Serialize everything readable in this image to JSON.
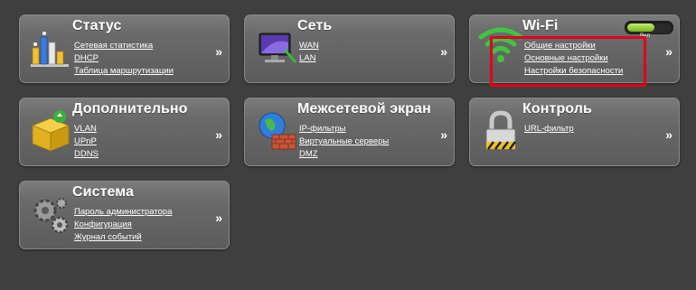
{
  "cards": {
    "status": {
      "title": "Статус",
      "links": [
        "Сетевая статистика",
        "DHCP",
        "Таблица маршрутизации"
      ],
      "arrow": "»"
    },
    "network": {
      "title": "Сеть",
      "links": [
        "WAN",
        "LAN"
      ],
      "arrow": "»"
    },
    "wifi": {
      "title": "Wi-Fi",
      "links": [
        "Общие настройки",
        "Основные настройки",
        "Настройки безопасности"
      ],
      "arrow": "»",
      "toggle_label": "Вкл",
      "toggle_on": true
    },
    "advanced": {
      "title": "Дополнительно",
      "links": [
        "VLAN",
        "UPnP",
        "DDNS"
      ],
      "arrow": "»"
    },
    "firewall": {
      "title": "Межсетевой экран",
      "links": [
        "IP-фильтры",
        "Виртуальные серверы",
        "DMZ"
      ],
      "arrow": "»"
    },
    "control": {
      "title": "Контроль",
      "links": [
        "URL-фильтр"
      ],
      "arrow": "»"
    },
    "system": {
      "title": "Система",
      "links": [
        "Пароль администратора",
        "Конфигурация",
        "Журнал событий"
      ],
      "arrow": "»"
    }
  },
  "icons": {
    "status": "bar-chart-icon",
    "network": "network-monitor-icon",
    "wifi": "wifi-signal-icon",
    "advanced": "package-box-icon",
    "firewall": "globe-firewall-icon",
    "control": "padlock-icon",
    "system": "gears-icon"
  },
  "colors": {
    "background": "#3f3f3f",
    "card": "#6a6a6a",
    "link": "#ffffff",
    "highlight": "#e0001a",
    "toggle_on": "#8ccd2c"
  }
}
